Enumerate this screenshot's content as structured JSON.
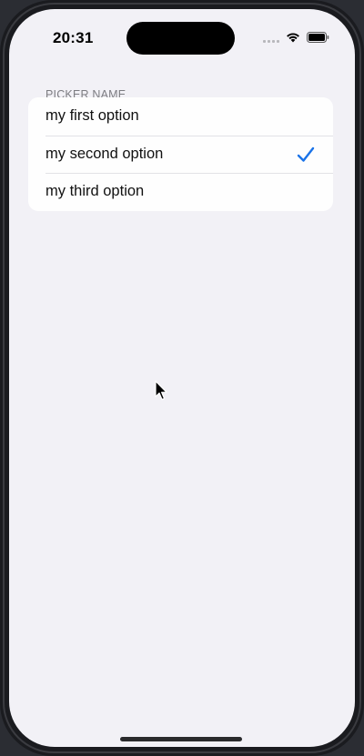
{
  "status_bar": {
    "time": "20:31"
  },
  "picker": {
    "header": "PICKER NAME",
    "options": [
      {
        "label": "my first option",
        "selected": false
      },
      {
        "label": "my second option",
        "selected": true
      },
      {
        "label": "my third option",
        "selected": false
      }
    ],
    "selected_index": 1
  },
  "icons": {
    "signal": "cellular-signal-icon",
    "wifi": "wifi-icon",
    "battery": "battery-icon",
    "checkmark": "checkmark-icon",
    "cursor": "mouse-pointer-icon"
  },
  "colors": {
    "background": "#f2f1f6",
    "list_background": "#fefefe",
    "accent": "#1a73e8",
    "header_text": "#7d7d82"
  }
}
